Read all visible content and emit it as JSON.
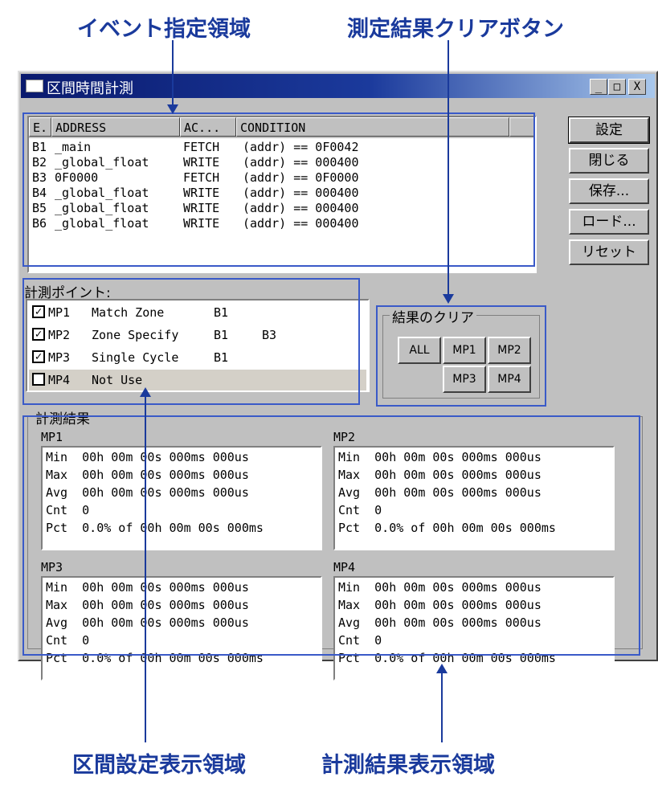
{
  "callouts": {
    "event_area": "イベント指定領域",
    "clear_button": "測定結果クリアボタン",
    "interval_area": "区間設定表示領域",
    "result_area": "計測結果表示領域"
  },
  "window": {
    "title": "区間時間計測",
    "controls": {
      "minimize": "_",
      "maximize": "□",
      "close": "X"
    }
  },
  "events": {
    "columns": [
      "E.",
      "ADDRESS",
      "AC...",
      "CONDITION"
    ],
    "rows": [
      {
        "e": "B1",
        "address": "_main",
        "ac": "FETCH",
        "condition": "(addr) == 0F0042"
      },
      {
        "e": "B2",
        "address": "_global_float",
        "ac": "WRITE",
        "condition": "(addr) == 000400"
      },
      {
        "e": "B3",
        "address": "0F0000",
        "ac": "FETCH",
        "condition": "(addr) == 0F0000"
      },
      {
        "e": "B4",
        "address": "_global_float",
        "ac": "WRITE",
        "condition": "(addr) == 000400"
      },
      {
        "e": "B5",
        "address": "_global_float",
        "ac": "WRITE",
        "condition": "(addr) == 000400"
      },
      {
        "e": "B6",
        "address": "_global_float",
        "ac": "WRITE",
        "condition": "(addr) == 000400"
      }
    ]
  },
  "buttons": {
    "set": "設定",
    "close": "閉じる",
    "save": "保存...",
    "load": "ロード...",
    "reset": "リセット"
  },
  "measure_points": {
    "label": "計測ポイント:",
    "items": [
      {
        "id": "MP1",
        "checked": true,
        "mode": "Match Zone",
        "ev1": "B1",
        "ev2": ""
      },
      {
        "id": "MP2",
        "checked": true,
        "mode": "Zone Specify",
        "ev1": "B1",
        "ev2": "B3"
      },
      {
        "id": "MP3",
        "checked": true,
        "mode": "Single Cycle",
        "ev1": "B1",
        "ev2": ""
      },
      {
        "id": "MP4",
        "checked": false,
        "mode": "Not Use",
        "ev1": "",
        "ev2": ""
      }
    ]
  },
  "clear_group": {
    "label": "結果のクリア",
    "all": "ALL",
    "mp1": "MP1",
    "mp2": "MP2",
    "mp3": "MP3",
    "mp4": "MP4"
  },
  "results": {
    "label": "計測結果",
    "panels": [
      {
        "name": "MP1",
        "lines": [
          "Min  00h 00m 00s 000ms 000us",
          "Max  00h 00m 00s 000ms 000us",
          "Avg  00h 00m 00s 000ms 000us",
          "Cnt  0",
          "Pct  0.0% of 00h 00m 00s 000ms"
        ]
      },
      {
        "name": "MP2",
        "lines": [
          "Min  00h 00m 00s 000ms 000us",
          "Max  00h 00m 00s 000ms 000us",
          "Avg  00h 00m 00s 000ms 000us",
          "Cnt  0",
          "Pct  0.0% of 00h 00m 00s 000ms"
        ]
      },
      {
        "name": "MP3",
        "lines": [
          "Min  00h 00m 00s 000ms 000us",
          "Max  00h 00m 00s 000ms 000us",
          "Avg  00h 00m 00s 000ms 000us",
          "Cnt  0",
          "Pct  0.0% of 00h 00m 00s 000ms"
        ]
      },
      {
        "name": "MP4",
        "lines": [
          "Min  00h 00m 00s 000ms 000us",
          "Max  00h 00m 00s 000ms 000us",
          "Avg  00h 00m 00s 000ms 000us",
          "Cnt  0",
          "Pct  0.0% of 00h 00m 00s 000ms"
        ]
      }
    ]
  },
  "colors": {
    "callout": "#1a3a9c",
    "highlight": "#3a5ac8",
    "window_face": "#c0c0c0"
  }
}
